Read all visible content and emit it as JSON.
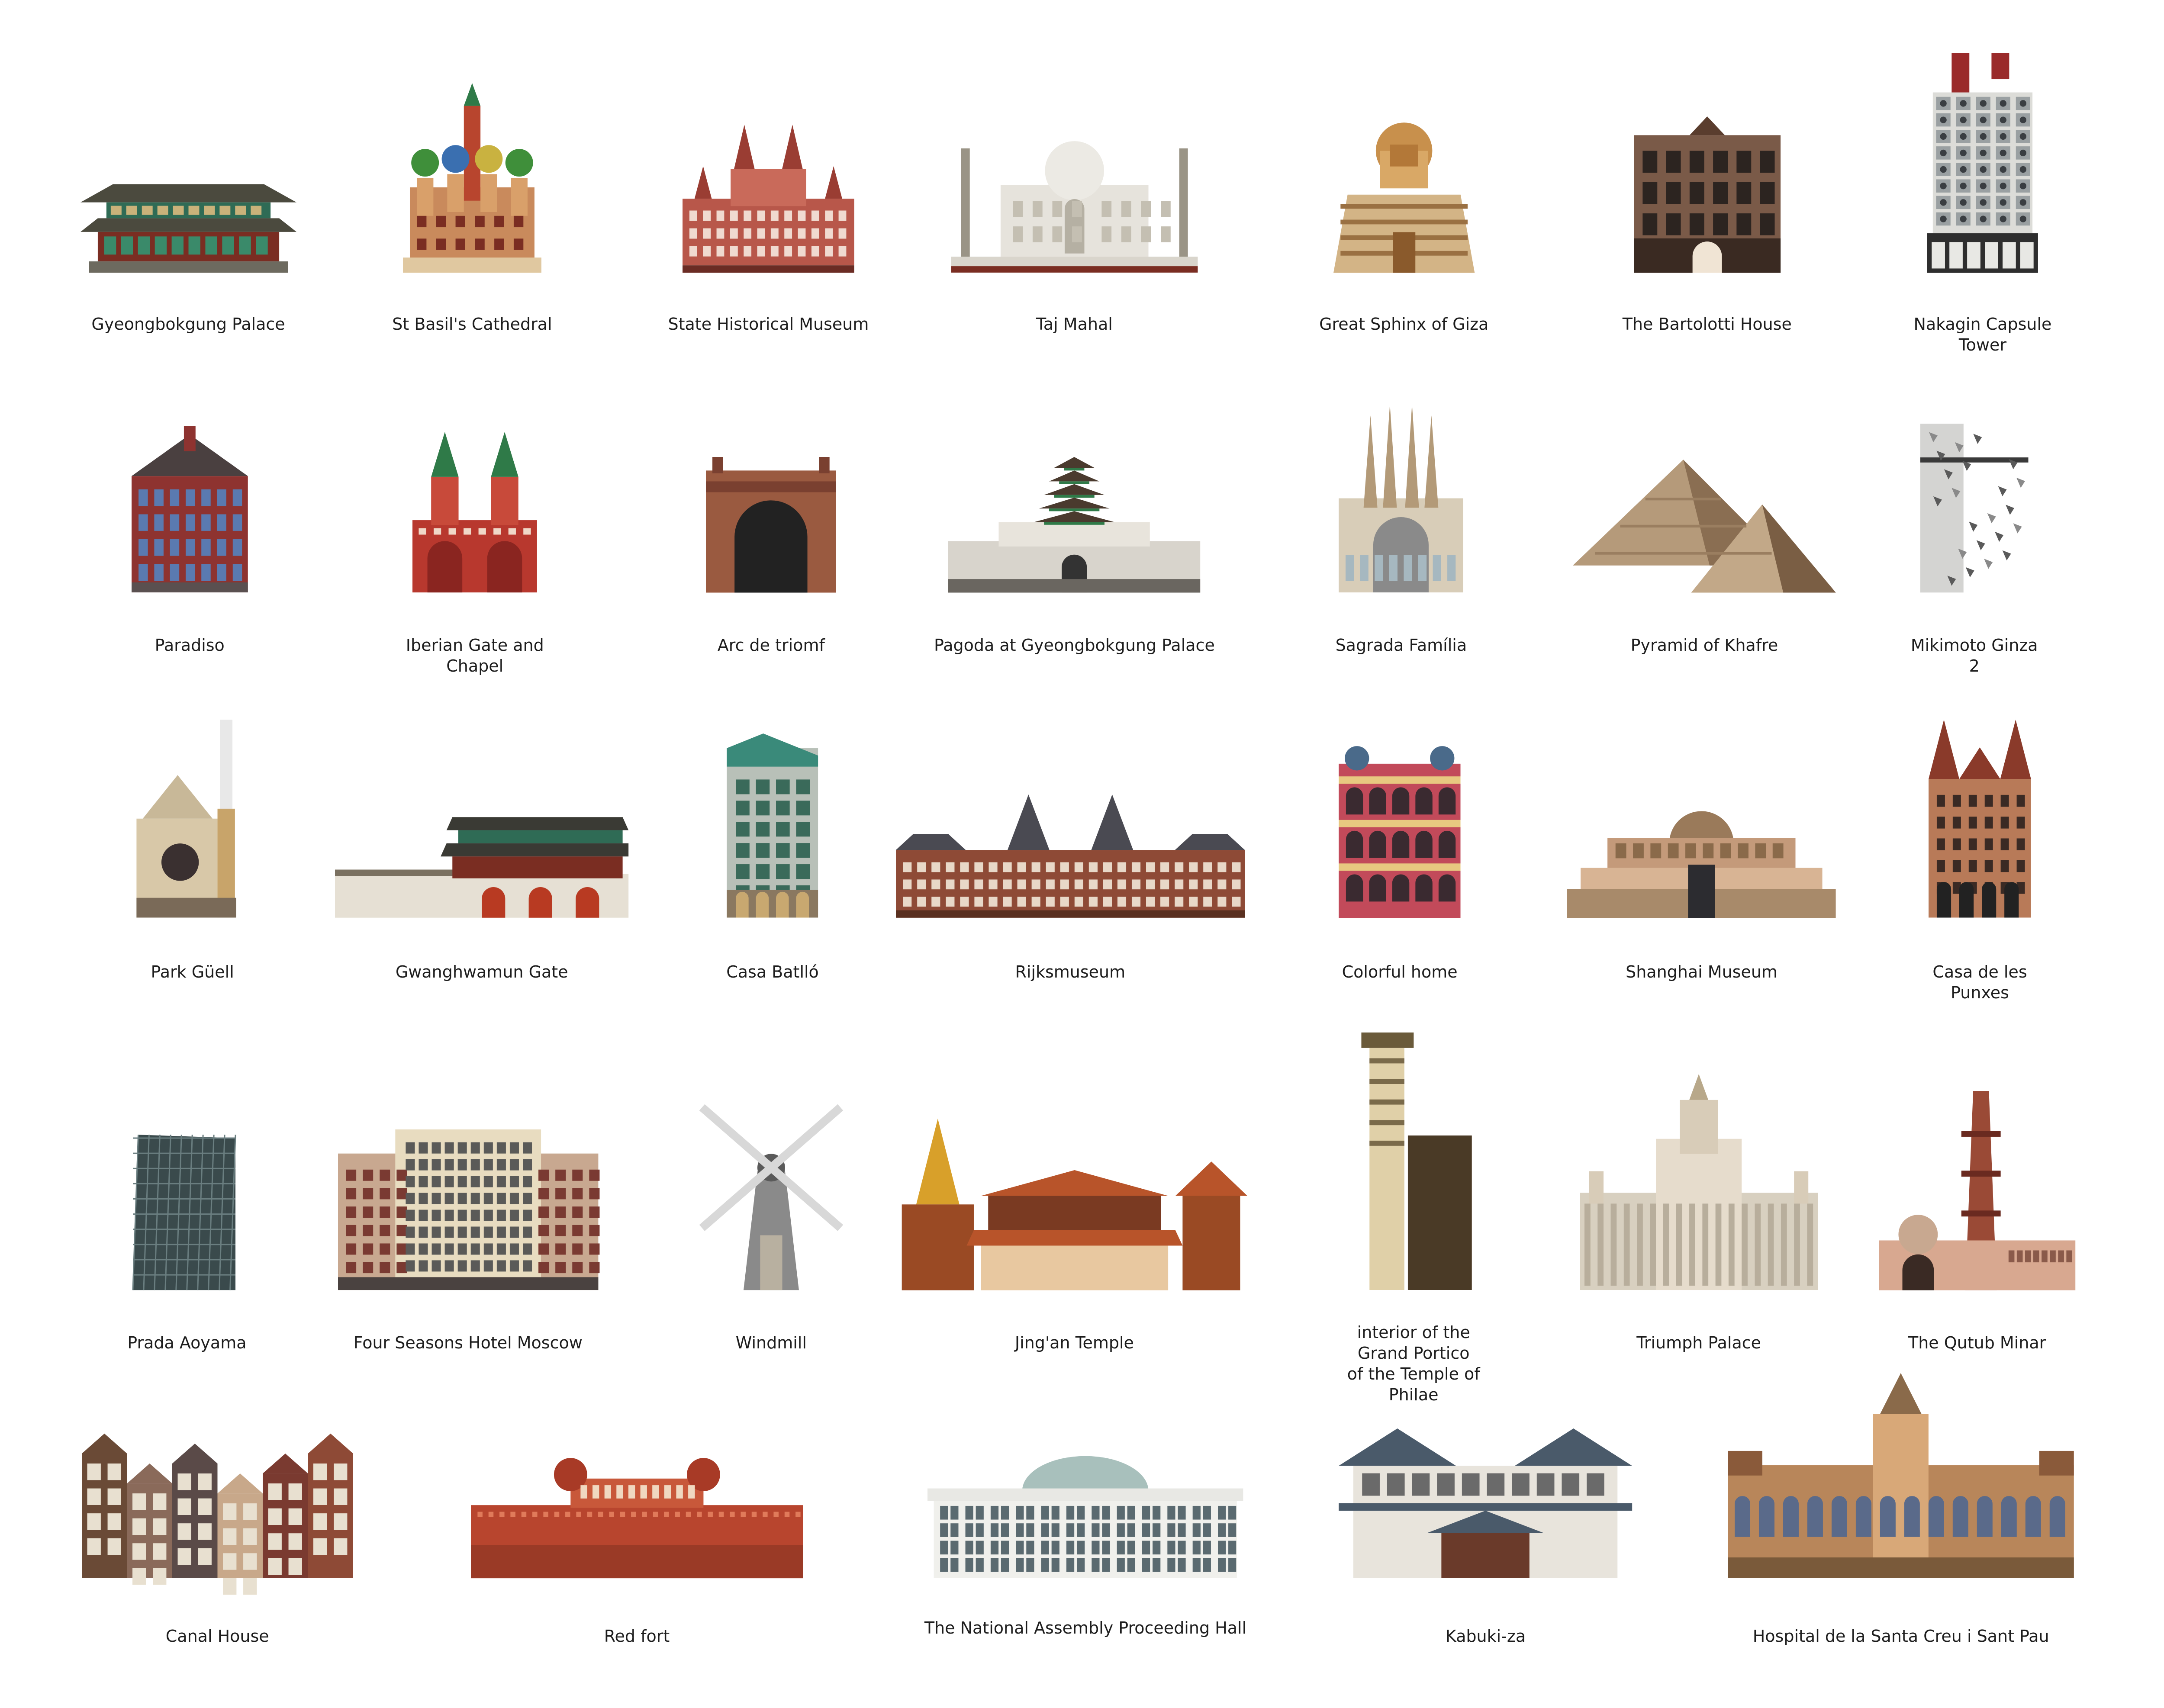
{
  "landmarks": [
    {
      "label": "Gyeongbokgung Palace",
      "icon": "korean-palace-icon"
    },
    {
      "label": "St Basil's Cathedral",
      "icon": "onion-dome-cathedral-icon"
    },
    {
      "label": "State Historical Museum",
      "icon": "red-brick-museum-icon"
    },
    {
      "label": "Taj Mahal",
      "icon": "taj-mahal-icon"
    },
    {
      "label": "Great Sphinx of Giza",
      "icon": "sphinx-icon"
    },
    {
      "label": "The Bartolotti House",
      "icon": "brick-townhouse-icon"
    },
    {
      "label": "Nakagin Capsule Tower",
      "icon": "capsule-tower-icon"
    },
    {
      "label": "Paradiso",
      "icon": "gabled-brick-building-icon"
    },
    {
      "label": "Iberian Gate and Chapel",
      "icon": "twin-tower-gate-icon"
    },
    {
      "label": "Arc de triomf",
      "icon": "triumphal-arch-icon"
    },
    {
      "label": "Pagoda at Gyeongbokgung Palace",
      "icon": "pagoda-icon"
    },
    {
      "label": "Sagrada Família",
      "icon": "spired-basilica-icon"
    },
    {
      "label": "Pyramid of Khafre",
      "icon": "pyramid-icon"
    },
    {
      "label": "Mikimoto Ginza 2",
      "icon": "perforated-tower-icon"
    },
    {
      "label": "Park Güell",
      "icon": "gaudi-pavilion-icon"
    },
    {
      "label": "Gwanghwamun Gate",
      "icon": "palace-gate-wall-icon"
    },
    {
      "label": "Casa Batlló",
      "icon": "modernist-facade-icon"
    },
    {
      "label": "Rijksmuseum",
      "icon": "museum-palace-icon"
    },
    {
      "label": "Colorful home",
      "icon": "ornate-pink-house-icon"
    },
    {
      "label": "Shanghai Museum",
      "icon": "round-top-museum-icon"
    },
    {
      "label": "Casa de les Punxes",
      "icon": "turreted-house-icon"
    },
    {
      "label": "Prada Aoyama",
      "icon": "glass-lattice-building-icon"
    },
    {
      "label": "Four Seasons Hotel Moscow",
      "icon": "grand-hotel-icon"
    },
    {
      "label": "Windmill",
      "icon": "windmill-icon"
    },
    {
      "label": "Jing'an Temple",
      "icon": "golden-temple-icon"
    },
    {
      "label": "interior of the Grand Portico\nof the Temple of Philae",
      "icon": "temple-column-icon"
    },
    {
      "label": "Triumph Palace",
      "icon": "stalinist-skyscraper-icon"
    },
    {
      "label": "The Qutub Minar",
      "icon": "minaret-icon"
    },
    {
      "label": "Canal House",
      "icon": "canal-houses-icon"
    },
    {
      "label": "Red fort",
      "icon": "red-fort-icon"
    },
    {
      "label": "The National Assembly Proceeding Hall",
      "icon": "domed-assembly-hall-icon"
    },
    {
      "label": "Kabuki-za",
      "icon": "kabuki-theatre-icon"
    },
    {
      "label": "Hospital de la Santa Creu i Sant Pau",
      "icon": "modernist-hospital-icon"
    }
  ]
}
